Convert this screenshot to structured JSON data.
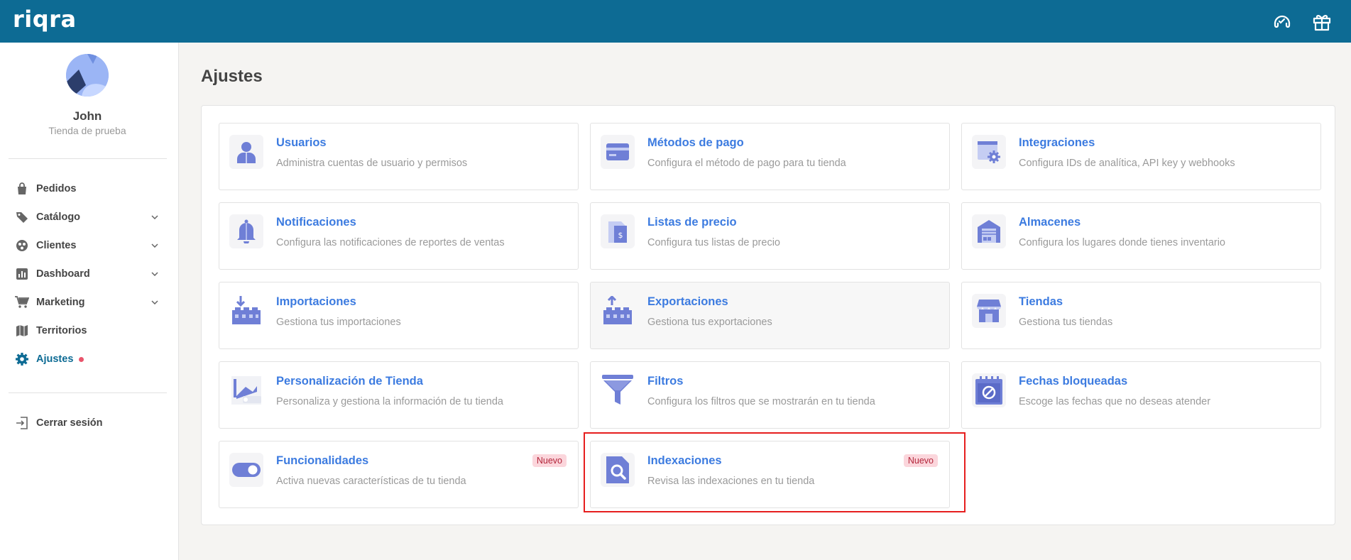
{
  "app": {
    "logo": "riqra"
  },
  "header": {
    "help_icon": "headset-icon",
    "gift_icon": "gift-icon"
  },
  "sidebar": {
    "user": {
      "name": "John",
      "store": "Tienda de prueba"
    },
    "items": [
      {
        "label": "Pedidos",
        "icon": "bag-icon",
        "expandable": false
      },
      {
        "label": "Catálogo",
        "icon": "tag-icon",
        "expandable": true
      },
      {
        "label": "Clientes",
        "icon": "users-icon",
        "expandable": true
      },
      {
        "label": "Dashboard",
        "icon": "chart-icon",
        "expandable": true
      },
      {
        "label": "Marketing",
        "icon": "cart-icon",
        "expandable": true
      },
      {
        "label": "Territorios",
        "icon": "map-icon",
        "expandable": false
      },
      {
        "label": "Ajustes",
        "icon": "gear-icon",
        "expandable": false,
        "active": true
      }
    ],
    "logout": "Cerrar sesión"
  },
  "main": {
    "title": "Ajustes",
    "badge_label": "Nuevo",
    "cards": [
      {
        "title": "Usuarios",
        "desc": "Administra cuentas de usuario y permisos",
        "icon": "user-icon"
      },
      {
        "title": "Métodos de pago",
        "desc": "Configura el método de pago para tu tienda",
        "icon": "credit-card-icon"
      },
      {
        "title": "Integraciones",
        "desc": "Configura IDs de analítica, API key y webhooks",
        "icon": "integrations-icon"
      },
      {
        "title": "Notificaciones",
        "desc": "Configura las notificaciones de reportes de ventas",
        "icon": "bell-icon"
      },
      {
        "title": "Listas de precio",
        "desc": "Configura tus listas de precio",
        "icon": "price-list-icon"
      },
      {
        "title": "Almacenes",
        "desc": "Configura los lugares donde tienes inventario",
        "icon": "warehouse-icon"
      },
      {
        "title": "Importaciones",
        "desc": "Gestiona tus importaciones",
        "icon": "import-icon"
      },
      {
        "title": "Exportaciones",
        "desc": "Gestiona tus exportaciones",
        "icon": "export-icon"
      },
      {
        "title": "Tiendas",
        "desc": "Gestiona tus tiendas",
        "icon": "store-icon"
      },
      {
        "title": "Personalización de Tienda",
        "desc": "Personaliza y gestiona la información de tu tienda",
        "icon": "customize-icon"
      },
      {
        "title": "Filtros",
        "desc": "Configura los filtros que se mostrarán en tu tienda",
        "icon": "filter-icon"
      },
      {
        "title": "Fechas bloqueadas",
        "desc": "Escoge las fechas que no deseas atender",
        "icon": "blocked-calendar-icon"
      },
      {
        "title": "Funcionalidades",
        "desc": "Activa nuevas características de tu tienda",
        "icon": "toggle-icon",
        "new": true
      },
      {
        "title": "Indexaciones",
        "desc": "Revisa las indexaciones en tu tienda",
        "icon": "search-doc-icon",
        "new": true
      }
    ]
  },
  "colors": {
    "header": "#0d6b94",
    "accent": "#3c7be0",
    "icon": "#6f7fd6",
    "badge_bg": "#fbd6dc",
    "badge_text": "#b3263b",
    "highlight": "#e61e1e"
  }
}
